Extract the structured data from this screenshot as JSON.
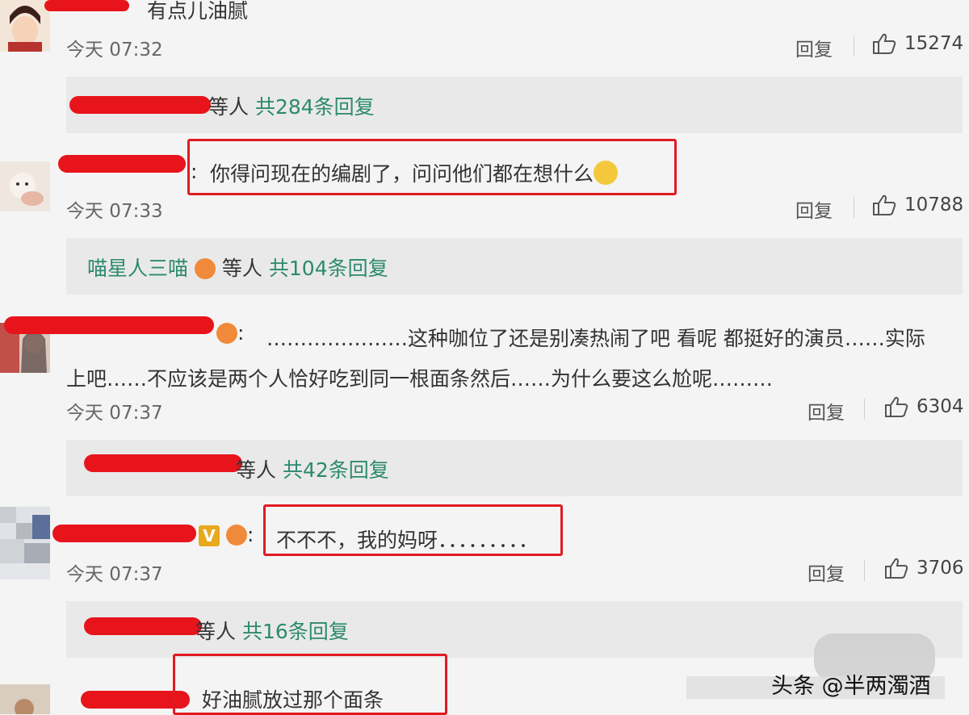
{
  "comments": [
    {
      "text": "有点儿油腻",
      "time": "今天 07:32",
      "reply_label": "回复",
      "likes": "15274",
      "replies_summary": {
        "prefix": "等人",
        "count": "共284条回复"
      }
    },
    {
      "text": "你得问现在的编剧了，问问他们都在想什么",
      "time": "今天 07:33",
      "reply_label": "回复",
      "likes": "10788",
      "replies_summary": {
        "name": "喵星人三喵",
        "prefix": "等人",
        "count": "共104条回复"
      }
    },
    {
      "text_line1": "…………………这种咖位了还是别凑热闹了吧 看呢 都挺好的演员……实际",
      "text_line2": "上吧……不应该是两个人恰好吃到同一根面条然后……为什么要这么尬呢………",
      "time": "今天 07:37",
      "reply_label": "回复",
      "likes": "6304",
      "replies_summary": {
        "prefix": "等人",
        "count": "共42条回复"
      }
    },
    {
      "text": "不不不，我的妈呀．．．．．．．．．",
      "time": "今天 07:37",
      "reply_label": "回复",
      "likes": "3706",
      "replies_summary": {
        "prefix": "等人",
        "count": "共16条回复"
      }
    },
    {
      "text": "好油腻放过那个面条"
    }
  ],
  "watermark": "头条 @半两濁酒",
  "colors": {
    "redaction": "#e8141c",
    "highlight_box": "#e11a22",
    "link_green": "#2c8a6e"
  }
}
